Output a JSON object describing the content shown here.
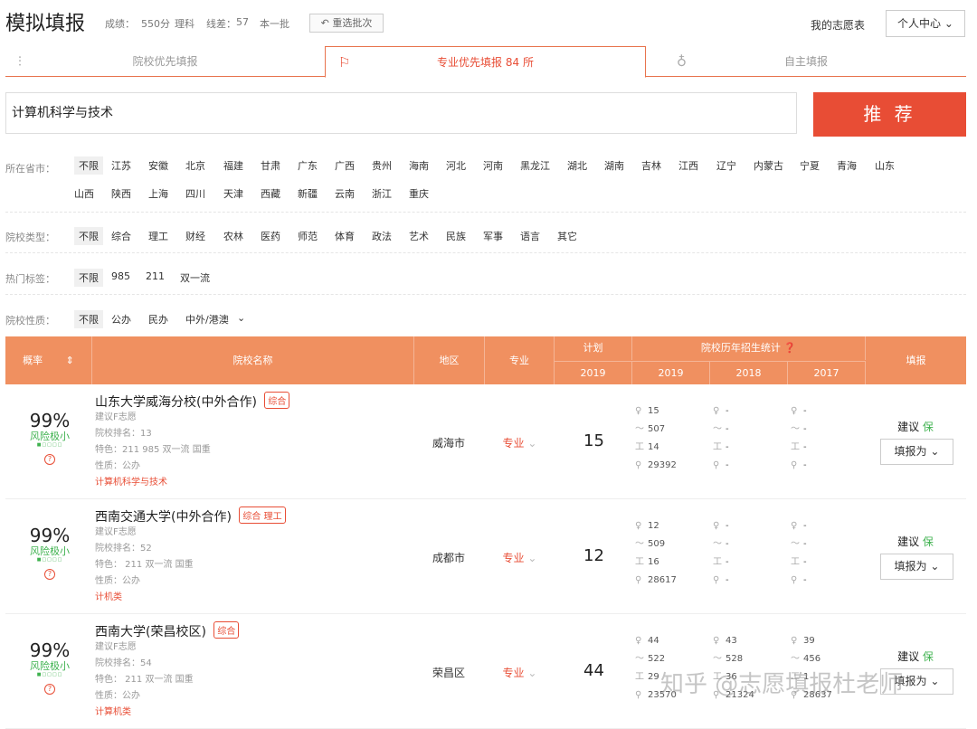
{
  "header": {
    "title": "模拟填报",
    "score_label": "成绩：",
    "score": "550分",
    "subject": "理科",
    "line_diff_label": "线差：",
    "line_diff": "57",
    "batch": "本一批",
    "reselect_button": "重选批次",
    "my_volunteer": "我的志愿表",
    "personal_center": "个人中心"
  },
  "tabs": [
    {
      "label": "院校优先填报",
      "icon": "sliders-icon"
    },
    {
      "label": "专业优先填报  84 所",
      "icon": "flag-icon"
    },
    {
      "label": "自主填报",
      "icon": "lightbulb-icon"
    }
  ],
  "search": {
    "value": "计算机科学与技术",
    "button": "推 荐"
  },
  "filters": {
    "province_label": "所在省市：",
    "provinces_row1": [
      "不限",
      "江苏",
      "安徽",
      "北京",
      "福建",
      "甘肃",
      "广东",
      "广西",
      "贵州",
      "海南",
      "河北",
      "河南",
      "黑龙江",
      "湖北",
      "湖南",
      "吉林",
      "江西",
      "辽宁",
      "内蒙古",
      "宁夏",
      "青海",
      "山东"
    ],
    "provinces_row2": [
      "山西",
      "陕西",
      "上海",
      "四川",
      "天津",
      "西藏",
      "新疆",
      "云南",
      "浙江",
      "重庆"
    ],
    "type_label": "院校类型：",
    "types": [
      "不限",
      "综合",
      "理工",
      "财经",
      "农林",
      "医药",
      "师范",
      "体育",
      "政法",
      "艺术",
      "民族",
      "军事",
      "语言",
      "其它"
    ],
    "hot_label": "热门标签：",
    "hot": [
      "不限",
      "985",
      "211",
      "双一流"
    ],
    "nature_label": "院校性质：",
    "nature": [
      "不限",
      "公办",
      "民办",
      "中外/港澳"
    ]
  },
  "table": {
    "headers": {
      "prob": "概率",
      "name": "院校名称",
      "region": "地区",
      "major": "专业",
      "plan": "计划",
      "plan_year": "2019",
      "history": "院校历年招生统计",
      "y2019": "2019",
      "y2018": "2018",
      "y2017": "2017",
      "fill": "填报"
    },
    "rows": [
      {
        "prob": "99%",
        "risk": "风险极小",
        "name": "山东大学威海分校(中外合作)",
        "tags": "综合",
        "suggest": "建议F志愿",
        "rank": "院校排名：13",
        "feature": "特色：211 985 双一流 国重",
        "nature": "性质：公办",
        "major_name": "计算机科学与技术",
        "region": "威海市",
        "major": "专业",
        "plan": "15",
        "s2019": [
          "15",
          "507",
          "14",
          "29392"
        ],
        "s2018": [
          "-",
          "-",
          "-",
          "-"
        ],
        "s2017": [
          "-",
          "-",
          "-",
          "-"
        ],
        "advice": "建议",
        "advice_tag": "保",
        "fill": "填报为"
      },
      {
        "prob": "99%",
        "risk": "风险极小",
        "name": "西南交通大学(中外合作)",
        "tags": "综合 理工",
        "suggest": "建议F志愿",
        "rank": "院校排名：52",
        "feature": "特色： 211 双一流 国重",
        "nature": "性质：公办",
        "major_name": "计机类",
        "region": "成都市",
        "major": "专业",
        "plan": "12",
        "s2019": [
          "12",
          "509",
          "16",
          "28617"
        ],
        "s2018": [
          "-",
          "-",
          "-",
          "-"
        ],
        "s2017": [
          "-",
          "-",
          "-",
          "-"
        ],
        "advice": "建议",
        "advice_tag": "保",
        "fill": "填报为"
      },
      {
        "prob": "99%",
        "risk": "风险极小",
        "name": "西南大学(荣昌校区)",
        "tags": "综合",
        "suggest": "建议F志愿",
        "rank": "院校排名：54",
        "feature": "特色： 211 双一流 国重",
        "nature": "性质：公办",
        "major_name": "计算机类",
        "region": "荣昌区",
        "major": "专业",
        "plan": "44",
        "s2019": [
          "44",
          "522",
          "29",
          "23570"
        ],
        "s2018": [
          "43",
          "528",
          "36",
          "21324"
        ],
        "s2017": [
          "39",
          "456",
          "1",
          "28637"
        ],
        "advice": "建议",
        "advice_tag": "保",
        "fill": "填报为"
      }
    ]
  },
  "watermark": "知乎 @志愿填报杜老师",
  "colors": {
    "accent": "#e84d35",
    "table_header": "#f09060",
    "safe": "#3fb24f"
  }
}
